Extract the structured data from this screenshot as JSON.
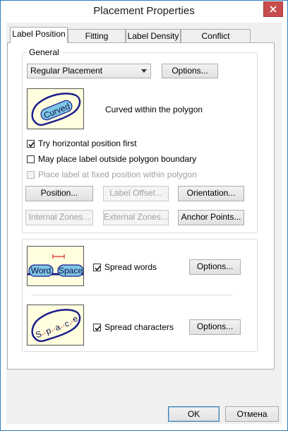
{
  "window": {
    "title": "Placement Properties"
  },
  "tabs": [
    {
      "label": "Label Position",
      "active": true
    },
    {
      "label": "Fitting Strategy",
      "active": false
    },
    {
      "label": "Label Density",
      "active": false
    },
    {
      "label": "Conflict Resolution",
      "active": false
    }
  ],
  "general": {
    "group_label": "General",
    "placement_select": {
      "value": "Regular Placement"
    },
    "options_label": "Options...",
    "preview_text": "Curved",
    "description": "Curved within the polygon",
    "try_horizontal": {
      "label": "Try horizontal position first",
      "checked": true
    },
    "outside_boundary": {
      "label": "May place label outside polygon boundary",
      "checked": false
    },
    "fixed_position": {
      "label": "Place label at fixed position within polygon",
      "checked": false,
      "enabled": false
    },
    "buttons": {
      "position": "Position...",
      "label_offset": "Label Offset...",
      "orientation": "Orientation...",
      "internal_zones": "Internal Zones...",
      "external_zones": "External Zones...",
      "anchor_points": "Anchor Points..."
    }
  },
  "spread": {
    "words": {
      "preview_left": "Word",
      "preview_right": "Space",
      "label": "Spread words",
      "checked": true,
      "options_label": "Options..."
    },
    "characters": {
      "preview_chars": [
        "S",
        "p",
        "a",
        "c",
        "e"
      ],
      "label": "Spread characters",
      "checked": true,
      "options_label": "Options..."
    }
  },
  "footer": {
    "ok": "OK",
    "cancel": "Отмена"
  },
  "colors": {
    "accent_border": "#2f7fc2",
    "polygon_stroke": "#1c1c8c",
    "label_fill": "#7ec6e6",
    "preview_bg": "#ffffdf",
    "close_red": "#c74d4d",
    "gap_marker": "#e03030"
  }
}
